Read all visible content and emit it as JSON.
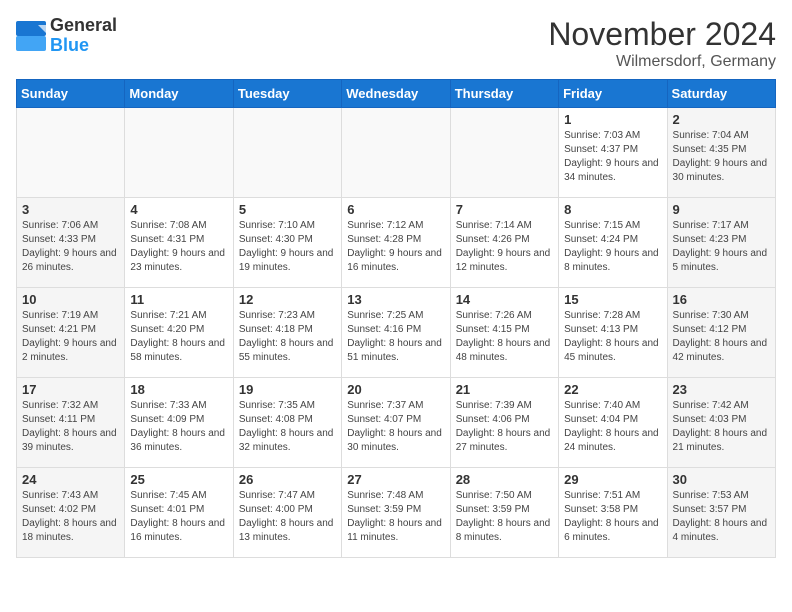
{
  "header": {
    "logo_general": "General",
    "logo_blue": "Blue",
    "month_title": "November 2024",
    "location": "Wilmersdorf, Germany"
  },
  "days_of_week": [
    "Sunday",
    "Monday",
    "Tuesday",
    "Wednesday",
    "Thursday",
    "Friday",
    "Saturday"
  ],
  "weeks": [
    [
      {
        "day": "",
        "info": ""
      },
      {
        "day": "",
        "info": ""
      },
      {
        "day": "",
        "info": ""
      },
      {
        "day": "",
        "info": ""
      },
      {
        "day": "",
        "info": ""
      },
      {
        "day": "1",
        "info": "Sunrise: 7:03 AM\nSunset: 4:37 PM\nDaylight: 9 hours and 34 minutes."
      },
      {
        "day": "2",
        "info": "Sunrise: 7:04 AM\nSunset: 4:35 PM\nDaylight: 9 hours and 30 minutes."
      }
    ],
    [
      {
        "day": "3",
        "info": "Sunrise: 7:06 AM\nSunset: 4:33 PM\nDaylight: 9 hours and 26 minutes."
      },
      {
        "day": "4",
        "info": "Sunrise: 7:08 AM\nSunset: 4:31 PM\nDaylight: 9 hours and 23 minutes."
      },
      {
        "day": "5",
        "info": "Sunrise: 7:10 AM\nSunset: 4:30 PM\nDaylight: 9 hours and 19 minutes."
      },
      {
        "day": "6",
        "info": "Sunrise: 7:12 AM\nSunset: 4:28 PM\nDaylight: 9 hours and 16 minutes."
      },
      {
        "day": "7",
        "info": "Sunrise: 7:14 AM\nSunset: 4:26 PM\nDaylight: 9 hours and 12 minutes."
      },
      {
        "day": "8",
        "info": "Sunrise: 7:15 AM\nSunset: 4:24 PM\nDaylight: 9 hours and 8 minutes."
      },
      {
        "day": "9",
        "info": "Sunrise: 7:17 AM\nSunset: 4:23 PM\nDaylight: 9 hours and 5 minutes."
      }
    ],
    [
      {
        "day": "10",
        "info": "Sunrise: 7:19 AM\nSunset: 4:21 PM\nDaylight: 9 hours and 2 minutes."
      },
      {
        "day": "11",
        "info": "Sunrise: 7:21 AM\nSunset: 4:20 PM\nDaylight: 8 hours and 58 minutes."
      },
      {
        "day": "12",
        "info": "Sunrise: 7:23 AM\nSunset: 4:18 PM\nDaylight: 8 hours and 55 minutes."
      },
      {
        "day": "13",
        "info": "Sunrise: 7:25 AM\nSunset: 4:16 PM\nDaylight: 8 hours and 51 minutes."
      },
      {
        "day": "14",
        "info": "Sunrise: 7:26 AM\nSunset: 4:15 PM\nDaylight: 8 hours and 48 minutes."
      },
      {
        "day": "15",
        "info": "Sunrise: 7:28 AM\nSunset: 4:13 PM\nDaylight: 8 hours and 45 minutes."
      },
      {
        "day": "16",
        "info": "Sunrise: 7:30 AM\nSunset: 4:12 PM\nDaylight: 8 hours and 42 minutes."
      }
    ],
    [
      {
        "day": "17",
        "info": "Sunrise: 7:32 AM\nSunset: 4:11 PM\nDaylight: 8 hours and 39 minutes."
      },
      {
        "day": "18",
        "info": "Sunrise: 7:33 AM\nSunset: 4:09 PM\nDaylight: 8 hours and 36 minutes."
      },
      {
        "day": "19",
        "info": "Sunrise: 7:35 AM\nSunset: 4:08 PM\nDaylight: 8 hours and 32 minutes."
      },
      {
        "day": "20",
        "info": "Sunrise: 7:37 AM\nSunset: 4:07 PM\nDaylight: 8 hours and 30 minutes."
      },
      {
        "day": "21",
        "info": "Sunrise: 7:39 AM\nSunset: 4:06 PM\nDaylight: 8 hours and 27 minutes."
      },
      {
        "day": "22",
        "info": "Sunrise: 7:40 AM\nSunset: 4:04 PM\nDaylight: 8 hours and 24 minutes."
      },
      {
        "day": "23",
        "info": "Sunrise: 7:42 AM\nSunset: 4:03 PM\nDaylight: 8 hours and 21 minutes."
      }
    ],
    [
      {
        "day": "24",
        "info": "Sunrise: 7:43 AM\nSunset: 4:02 PM\nDaylight: 8 hours and 18 minutes."
      },
      {
        "day": "25",
        "info": "Sunrise: 7:45 AM\nSunset: 4:01 PM\nDaylight: 8 hours and 16 minutes."
      },
      {
        "day": "26",
        "info": "Sunrise: 7:47 AM\nSunset: 4:00 PM\nDaylight: 8 hours and 13 minutes."
      },
      {
        "day": "27",
        "info": "Sunrise: 7:48 AM\nSunset: 3:59 PM\nDaylight: 8 hours and 11 minutes."
      },
      {
        "day": "28",
        "info": "Sunrise: 7:50 AM\nSunset: 3:59 PM\nDaylight: 8 hours and 8 minutes."
      },
      {
        "day": "29",
        "info": "Sunrise: 7:51 AM\nSunset: 3:58 PM\nDaylight: 8 hours and 6 minutes."
      },
      {
        "day": "30",
        "info": "Sunrise: 7:53 AM\nSunset: 3:57 PM\nDaylight: 8 hours and 4 minutes."
      }
    ]
  ]
}
